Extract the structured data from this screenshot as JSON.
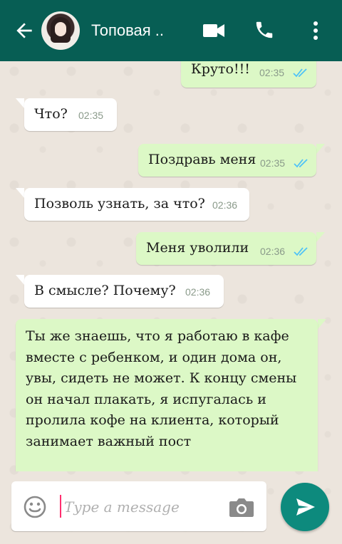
{
  "header": {
    "title": "Топовая ..",
    "icons": [
      "back-arrow-icon",
      "avatar",
      "video-call-icon",
      "phone-call-icon",
      "more-vert-icon"
    ],
    "bar_color": "#075e54"
  },
  "messages": [
    {
      "dir": "out",
      "text": "Круто!!!",
      "time": "02:35",
      "read": true
    },
    {
      "dir": "in",
      "text": "Что?",
      "time": "02:35"
    },
    {
      "dir": "out",
      "text": "Поздравь меня",
      "time": "02:35",
      "read": true
    },
    {
      "dir": "in",
      "text": "Позволь узнать, за что?",
      "time": "02:36"
    },
    {
      "dir": "out",
      "text": "Меня уволили",
      "time": "02:36",
      "read": true
    },
    {
      "dir": "in",
      "text": "В смысле? Почему?",
      "time": "02:36"
    },
    {
      "dir": "out",
      "text": "Ты же знаешь, что я работаю в кафе вместе с ребенком, и один дома он, увы, сидеть не может. К концу смены он начал плакать, я испугалась и пролила кофе на клиента, который занимает важный пост"
    }
  ],
  "composer": {
    "placeholder": "Type a message"
  },
  "colors": {
    "incoming": "#ffffff",
    "outgoing": "#dcf8c6",
    "tick": "#4fc3f7",
    "send": "#0d8a7d"
  }
}
